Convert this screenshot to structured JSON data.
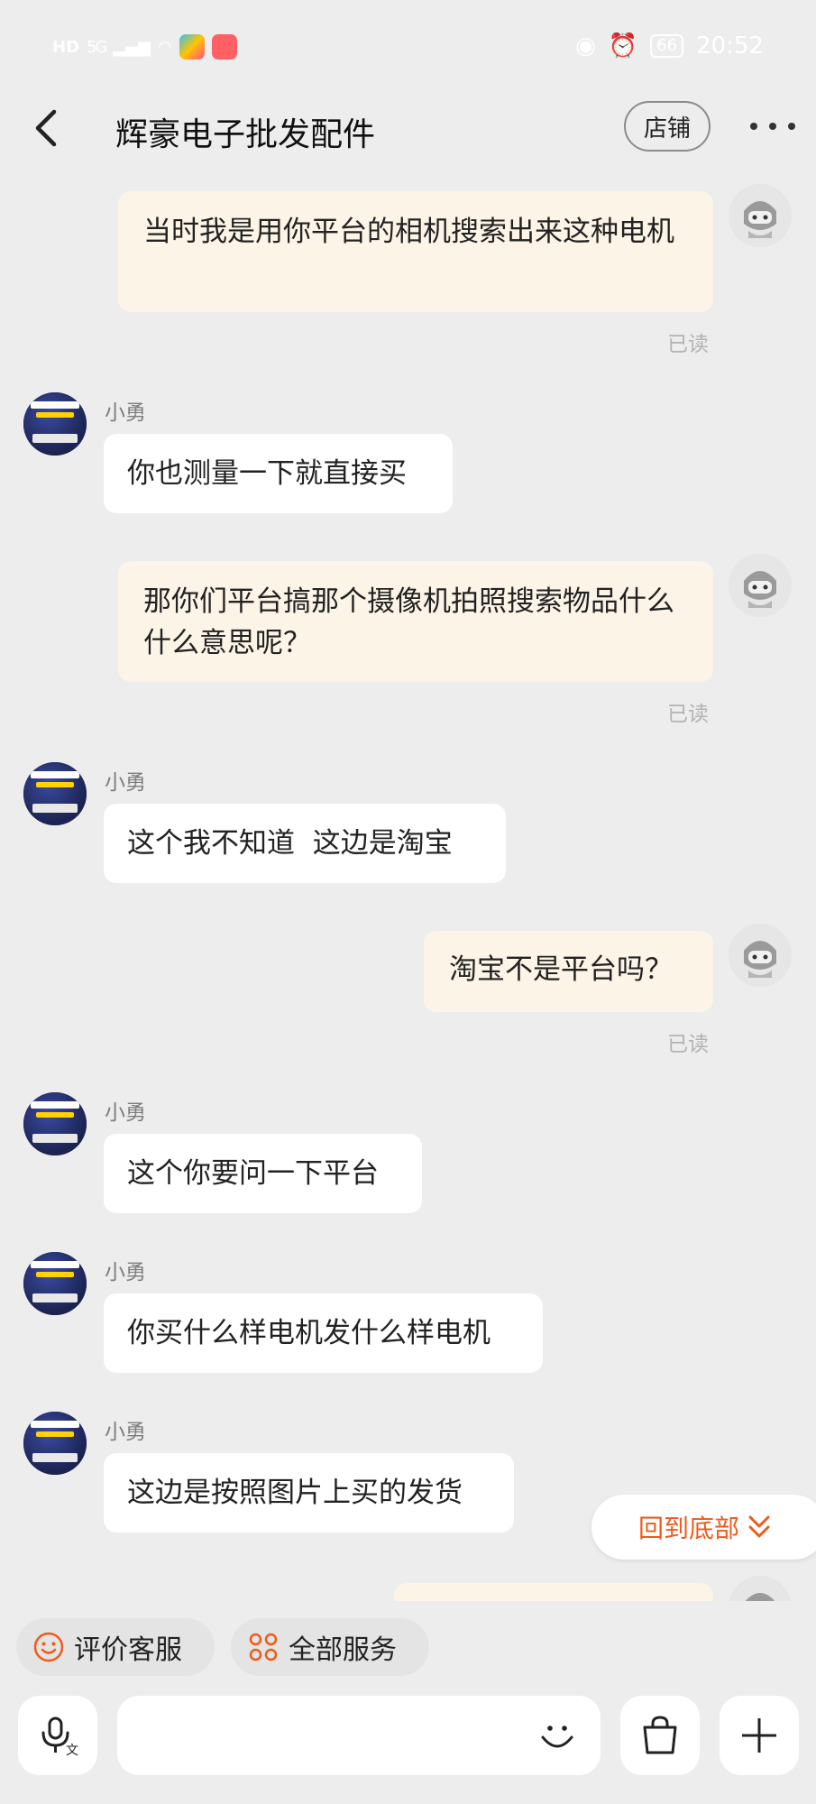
{
  "status_bar": {
    "network": "HD",
    "signal": "5G",
    "battery": "66",
    "time": "20:52"
  },
  "header": {
    "title": "辉豪电子批发配件",
    "shop_button": "店铺"
  },
  "messages": [
    {
      "side": "right",
      "text": "当时我是用你平台的相机搜索出来这种电机",
      "read": "已读"
    },
    {
      "side": "left",
      "sender": "小勇",
      "text": "你也测量一下就直接买"
    },
    {
      "side": "right",
      "text": "那你们平台搞那个摄像机拍照搜索物品什么什么意思呢？",
      "read": "已读"
    },
    {
      "side": "left",
      "sender": "小勇",
      "text": "这个我不知道  这边是淘宝"
    },
    {
      "side": "right",
      "text": "淘宝不是平台吗？",
      "read": "已读"
    },
    {
      "side": "left",
      "sender": "小勇",
      "text": "这个你要问一下平台"
    },
    {
      "side": "left",
      "sender": "小勇",
      "text": "你买什么样电机发什么样电机"
    },
    {
      "side": "left",
      "sender": "小勇",
      "text": "这边是按照图片上买的发货"
    }
  ],
  "jump_to_bottom": "回到底部",
  "services": {
    "rate": "评价客服",
    "all": "全部服务"
  },
  "input": {
    "voice_badge": "文",
    "placeholder": ""
  },
  "colors": {
    "accent": "#f05a1a",
    "bubble_self": "#fdf4e8",
    "bubble_other": "#ffffff",
    "background": "#ededed"
  },
  "icons": {
    "back": "back-arrow-icon",
    "more": "more-dots-icon",
    "voice": "microphone-icon",
    "emoji": "smile-icon",
    "bag": "shopping-bag-icon",
    "plus": "plus-icon"
  }
}
